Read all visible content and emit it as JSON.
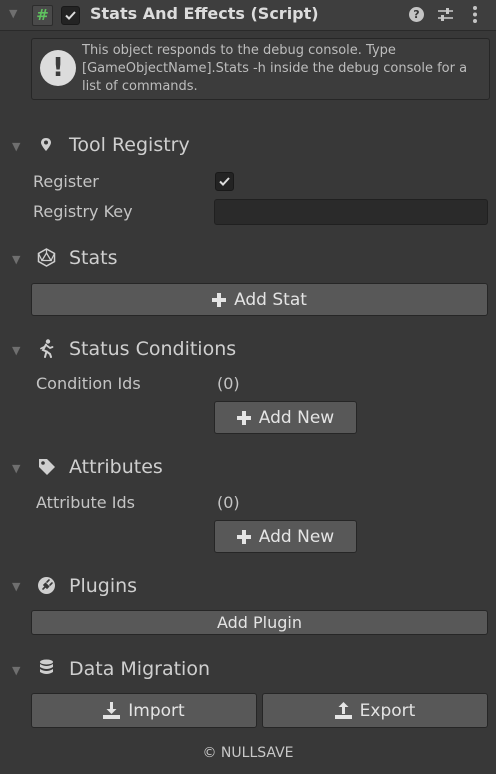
{
  "header": {
    "title": "Stats And Effects (Script)",
    "script_icon": "#",
    "help_icon": "?"
  },
  "info": {
    "icon": "!",
    "message": "This object responds to the debug console. Type [GameObjectName].Stats -h inside the debug console for a list of commands."
  },
  "sections": {
    "tool_registry": {
      "title": "Tool Registry",
      "register_label": "Register",
      "register_checked": true,
      "registry_key_label": "Registry Key",
      "registry_key_value": ""
    },
    "stats": {
      "title": "Stats",
      "add_button": "Add Stat"
    },
    "status_conditions": {
      "title": "Status Conditions",
      "list_label": "Condition Ids",
      "count": "(0)",
      "add_button": "Add New"
    },
    "attributes": {
      "title": "Attributes",
      "list_label": "Attribute Ids",
      "count": "(0)",
      "add_button": "Add New"
    },
    "plugins": {
      "title": "Plugins",
      "add_button": "Add Plugin"
    },
    "data_migration": {
      "title": "Data Migration",
      "import_button": "Import",
      "export_button": "Export"
    }
  },
  "footer": {
    "copyright": "© NULLSAVE"
  },
  "colors": {
    "background": "#383838",
    "header": "#3e3e3e",
    "button": "#585858",
    "text": "#c4c4c4",
    "script_green": "#5fc35f"
  }
}
